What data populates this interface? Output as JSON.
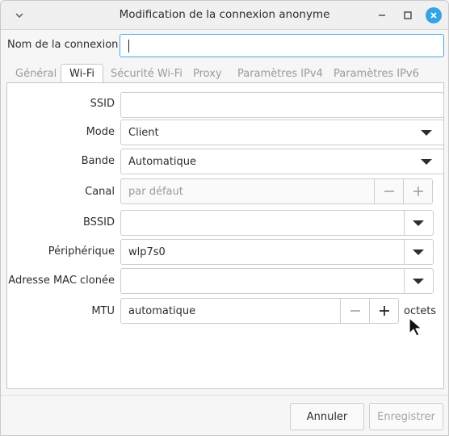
{
  "window": {
    "title": "Modification de la connexion anonyme"
  },
  "connection": {
    "name_label": "Nom de la connexion",
    "name_value": ""
  },
  "tabs": [
    {
      "label": "Général",
      "active": false
    },
    {
      "label": "Wi-Fi",
      "active": true
    },
    {
      "label": "Sécurité Wi-Fi",
      "active": false
    },
    {
      "label": "Proxy",
      "active": false
    },
    {
      "label": "Paramètres IPv4",
      "active": false
    },
    {
      "label": "Paramètres IPv6",
      "active": false
    }
  ],
  "wifi": {
    "ssid": {
      "label": "SSID",
      "value": ""
    },
    "mode": {
      "label": "Mode",
      "value": "Client"
    },
    "band": {
      "label": "Bande",
      "value": "Automatique"
    },
    "channel": {
      "label": "Canal",
      "placeholder": "par défaut"
    },
    "bssid": {
      "label": "BSSID",
      "value": ""
    },
    "device": {
      "label": "Périphérique",
      "value": "wlp7s0"
    },
    "cloned_mac": {
      "label": "Adresse MAC clonée",
      "value": ""
    },
    "mtu": {
      "label": "MTU",
      "value": "automatique",
      "unit": "octets"
    }
  },
  "footer": {
    "cancel_label": "Annuler",
    "save_label": "Enregistrer"
  },
  "colors": {
    "accent": "#35a4e3",
    "focus_border": "#4aa6e0"
  }
}
